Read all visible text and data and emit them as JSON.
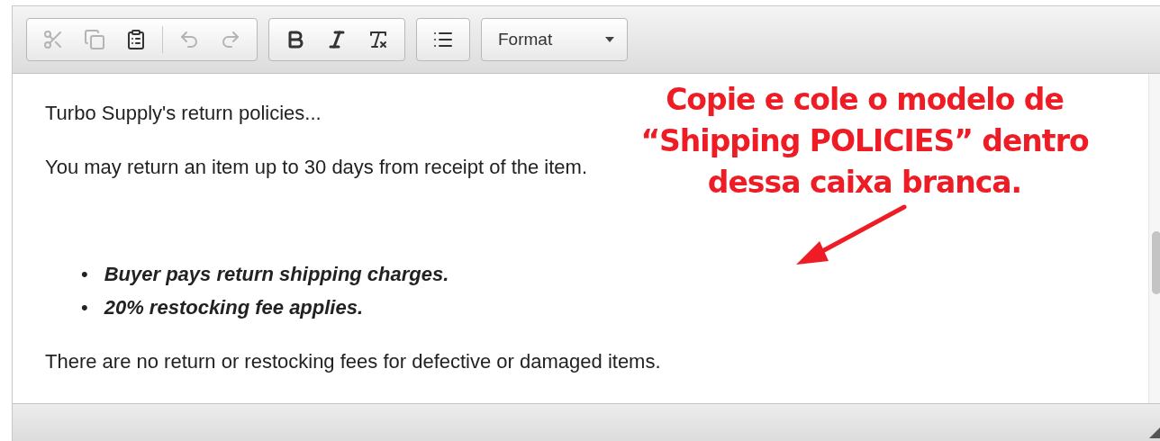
{
  "toolbar": {
    "groups": [
      {
        "buttons": [
          {
            "kind": "cut",
            "disabled": true
          },
          {
            "kind": "copy",
            "disabled": true
          },
          {
            "kind": "paste",
            "disabled": false
          },
          {
            "kind": "separator"
          },
          {
            "kind": "undo",
            "disabled": true
          },
          {
            "kind": "redo",
            "disabled": true
          }
        ]
      },
      {
        "buttons": [
          {
            "kind": "bold",
            "disabled": false
          },
          {
            "kind": "italic",
            "disabled": false
          },
          {
            "kind": "clear-format",
            "disabled": false
          }
        ]
      },
      {
        "buttons": [
          {
            "kind": "bullet-list",
            "disabled": false
          }
        ]
      }
    ],
    "format": {
      "label": "Format"
    }
  },
  "content": [
    {
      "kind": "paragraph",
      "text": "Turbo Supply's return policies..."
    },
    {
      "kind": "paragraph",
      "text": "You may return an item up to 30 days from receipt of the item."
    },
    {
      "kind": "spacer"
    },
    {
      "kind": "list",
      "marker": "•",
      "items": [
        "Buyer pays return shipping charges.",
        "20% restocking fee applies."
      ]
    },
    {
      "kind": "paragraph",
      "text": "There are no return or restocking fees for defective or damaged items."
    }
  ],
  "annotation": {
    "lines": [
      "Copie e cole o modelo de",
      "“Shipping POLICIES” dentro",
      "dessa caixa branca."
    ]
  }
}
